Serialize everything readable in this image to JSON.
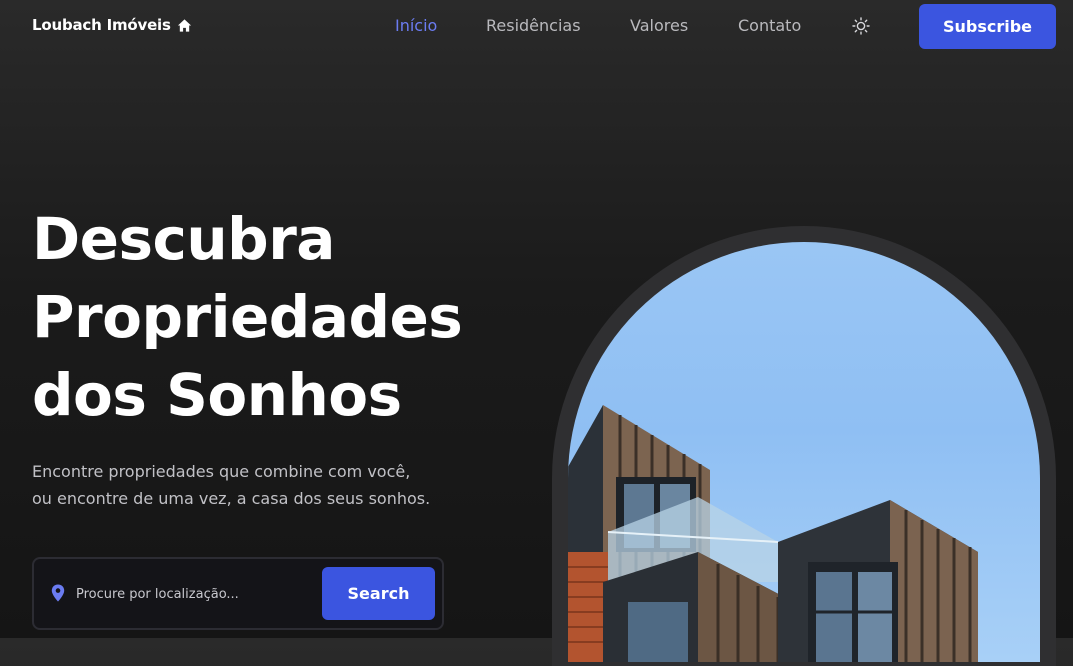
{
  "header": {
    "brand": "Loubach Imóveis",
    "nav": [
      {
        "label": "Início",
        "active": true
      },
      {
        "label": "Residências",
        "active": false
      },
      {
        "label": "Valores",
        "active": false
      },
      {
        "label": "Contato",
        "active": false
      }
    ],
    "theme_icon": "sun-icon",
    "subscribe_label": "Subscribe"
  },
  "hero": {
    "title_lines": [
      "Descubra",
      "Propriedades",
      "dos Sonhos"
    ],
    "subtitle_lines": [
      "Encontre propriedades que combine com você,",
      "ou encontre de uma vez, a casa dos seus sonhos."
    ],
    "search": {
      "placeholder": "Procure por localização...",
      "button_label": "Search",
      "icon": "location-pin-icon"
    }
  },
  "colors": {
    "accent": "#3b55e0",
    "nav_active": "#6b7cf1",
    "background": "#1b1b1b"
  }
}
